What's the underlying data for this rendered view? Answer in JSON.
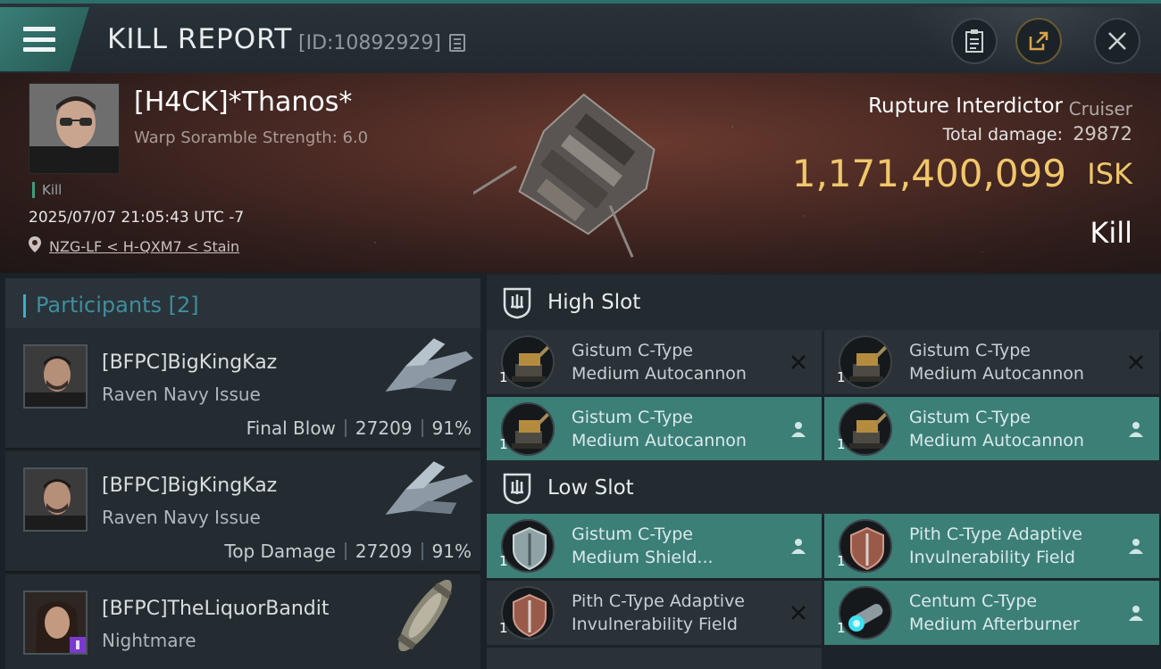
{
  "topbar": {
    "title": "KILL REPORT",
    "report_id": "[ID:10892929]"
  },
  "victim": {
    "name": "[H4CK]*Thanos*",
    "scramble": "Warp Soramble Strength: 6.0",
    "tag": "Kill",
    "time": "2025/07/07 21:05:43 UTC -7",
    "location": "NZG-LF < H-QXM7 < Stain",
    "ship_name": "Rupture Interdictor",
    "ship_class": "Cruiser",
    "damage_label": "Total damage:",
    "damage_value": "29872",
    "isk_value": "1,171,400,099",
    "isk_unit": "ISK",
    "result": "Kill"
  },
  "participants": {
    "header": "Participants [2]",
    "rows": [
      {
        "name": "[BFPC]BigKingKaz",
        "ship": "Raven Navy Issue",
        "stat_label": "Final Blow",
        "damage": "27209",
        "percent": "91%"
      },
      {
        "name": "[BFPC]BigKingKaz",
        "ship": "Raven Navy Issue",
        "stat_label": "Top Damage",
        "damage": "27209",
        "percent": "91%"
      },
      {
        "name": "[BFPC]TheLiquorBandit",
        "ship": "Nightmare"
      }
    ]
  },
  "fittings": {
    "high_slot_title": "High Slot",
    "low_slot_title": "Low Slot",
    "high": [
      {
        "line1": "Gistum C-Type",
        "line2": "Medium Autocannon",
        "qty": "1",
        "status": "destroyed"
      },
      {
        "line1": "Gistum C-Type",
        "line2": "Medium Autocannon",
        "qty": "1",
        "status": "destroyed"
      },
      {
        "line1": "Gistum C-Type",
        "line2": "Medium Autocannon",
        "qty": "1",
        "status": "dropped"
      },
      {
        "line1": "Gistum C-Type",
        "line2": "Medium Autocannon",
        "qty": "1",
        "status": "dropped"
      }
    ],
    "low": [
      {
        "line1": "Gistum C-Type",
        "line2": "Medium Shield...",
        "qty": "1",
        "status": "dropped"
      },
      {
        "line1": "Pith C-Type Adaptive",
        "line2": "Invulnerability Field",
        "qty": "1",
        "status": "dropped"
      },
      {
        "line1": "Pith C-Type Adaptive",
        "line2": "Invulnerability Field",
        "qty": "1",
        "status": "destroyed"
      },
      {
        "line1": "Centum C-Type",
        "line2": "Medium Afterburner",
        "qty": "1",
        "status": "dropped"
      }
    ]
  },
  "colors": {
    "accent": "#3b7f77",
    "isk": "#f0c76a",
    "participants_header": "#3e8e9e"
  }
}
